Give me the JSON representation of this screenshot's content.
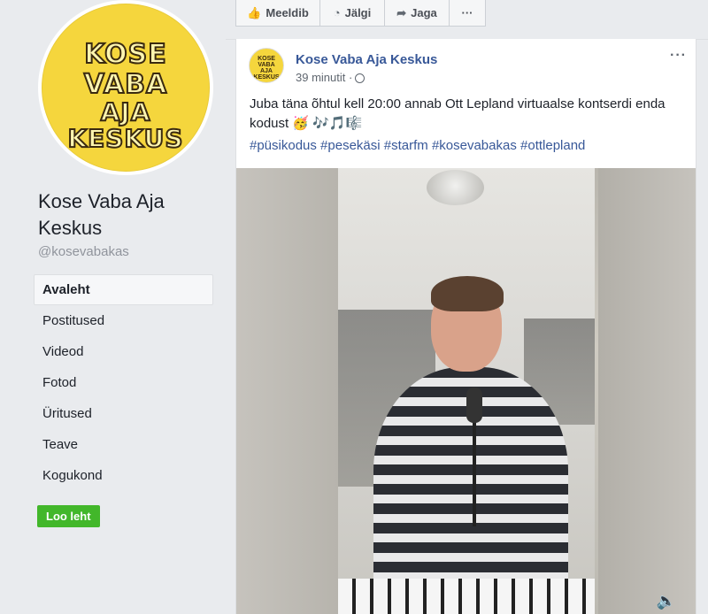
{
  "sidebar": {
    "logo_lines": [
      "KOSE",
      "VABA",
      "AJA",
      "KESKUS"
    ],
    "page_name": "Kose Vaba Aja Keskus",
    "handle": "@kosevabakas",
    "nav_items": [
      {
        "label": "Avaleht",
        "active": true
      },
      {
        "label": "Postitused"
      },
      {
        "label": "Videod"
      },
      {
        "label": "Fotod"
      },
      {
        "label": "Üritused"
      },
      {
        "label": "Teave"
      },
      {
        "label": "Kogukond"
      }
    ],
    "create_page_label": "Loo leht"
  },
  "action_bar": {
    "like_label": "Meeldib",
    "follow_label": "Jälgi",
    "share_label": "Jaga",
    "more_label": "···"
  },
  "post": {
    "author": "Kose Vaba Aja Keskus",
    "time": "39 minutit ·",
    "menu_label": "···",
    "text": "Juba täna õhtul kell 20:00 annab Ott Lepland virtuaalse kontserdi enda kodust 🥳 🎶🎵🎼",
    "hashtags": "#püsikodus #pesekäsi #starfm #kosevabakas #ottlepland",
    "volume_icon": "🔈"
  },
  "colors": {
    "brand_blue": "#385898",
    "green": "#42b72a",
    "background": "#e9ebee",
    "logo_yellow": "#f5d63d"
  }
}
